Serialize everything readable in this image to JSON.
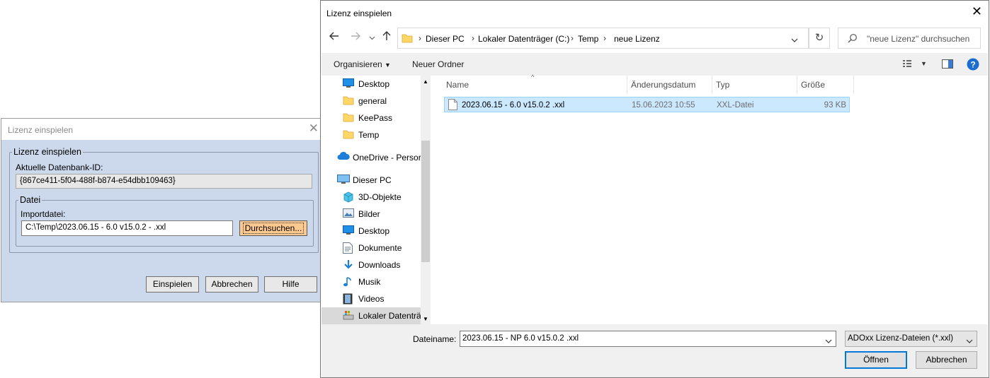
{
  "left_dialog": {
    "title": "Lizenz einspielen",
    "group_title": "Lizenz einspielen",
    "db_id_label": "Aktuelle Datenbank-ID:",
    "db_id_value": "{867ce411-5f04-488f-b874-e54dbb109463}",
    "file_group_title": "Datei",
    "import_label": "Importdatei:",
    "import_value": "C:\\Temp\\2023.06.15 - 6.0 v15.0.2 - .xxl",
    "browse_label": "Durchsuchen...",
    "buttons": {
      "apply": "Einspielen",
      "cancel": "Abbrechen",
      "help": "Hilfe"
    }
  },
  "file_dialog": {
    "title": "Lizenz einspielen",
    "breadcrumb": [
      "Dieser PC",
      "Lokaler Datenträger (C:)",
      "Temp",
      "neue Lizenz"
    ],
    "search_placeholder": "\"neue Lizenz\" durchsuchen",
    "toolbar": {
      "organize": "Organisieren",
      "new_folder": "Neuer Ordner"
    },
    "nav_items": [
      {
        "label": "Desktop",
        "icon": "desktop-icon"
      },
      {
        "label": "general",
        "icon": "folder-icon"
      },
      {
        "label": "KeePass",
        "icon": "folder-icon"
      },
      {
        "label": "Temp",
        "icon": "folder-icon"
      },
      {
        "label": "OneDrive - Persor",
        "icon": "cloud-icon"
      },
      {
        "label": "Dieser PC",
        "icon": "pc-icon"
      },
      {
        "label": "3D-Objekte",
        "icon": "cube-icon"
      },
      {
        "label": "Bilder",
        "icon": "pictures-icon"
      },
      {
        "label": "Desktop",
        "icon": "desktop-icon"
      },
      {
        "label": "Dokumente",
        "icon": "documents-icon"
      },
      {
        "label": "Downloads",
        "icon": "download-icon"
      },
      {
        "label": "Musik",
        "icon": "music-icon"
      },
      {
        "label": "Videos",
        "icon": "video-icon"
      },
      {
        "label": "Lokaler Datenträ",
        "icon": "drive-icon"
      }
    ],
    "columns": {
      "name": "Name",
      "date": "Änderungsdatum",
      "type": "Typ",
      "size": "Größe"
    },
    "files": [
      {
        "name": "2023.06.15 - 6.0 v15.0.2 .xxl",
        "date": "15.06.2023 10:55",
        "type": "XXL-Datei",
        "size": "93 KB"
      }
    ],
    "filename_label": "Dateiname:",
    "filename_value": "2023.06.15 - NP 6.0 v15.0.2 .xxl",
    "filetype_value": "ADOxx Lizenz-Dateien (*.xxl)",
    "buttons": {
      "open": "Öffnen",
      "cancel": "Abbrechen"
    }
  }
}
